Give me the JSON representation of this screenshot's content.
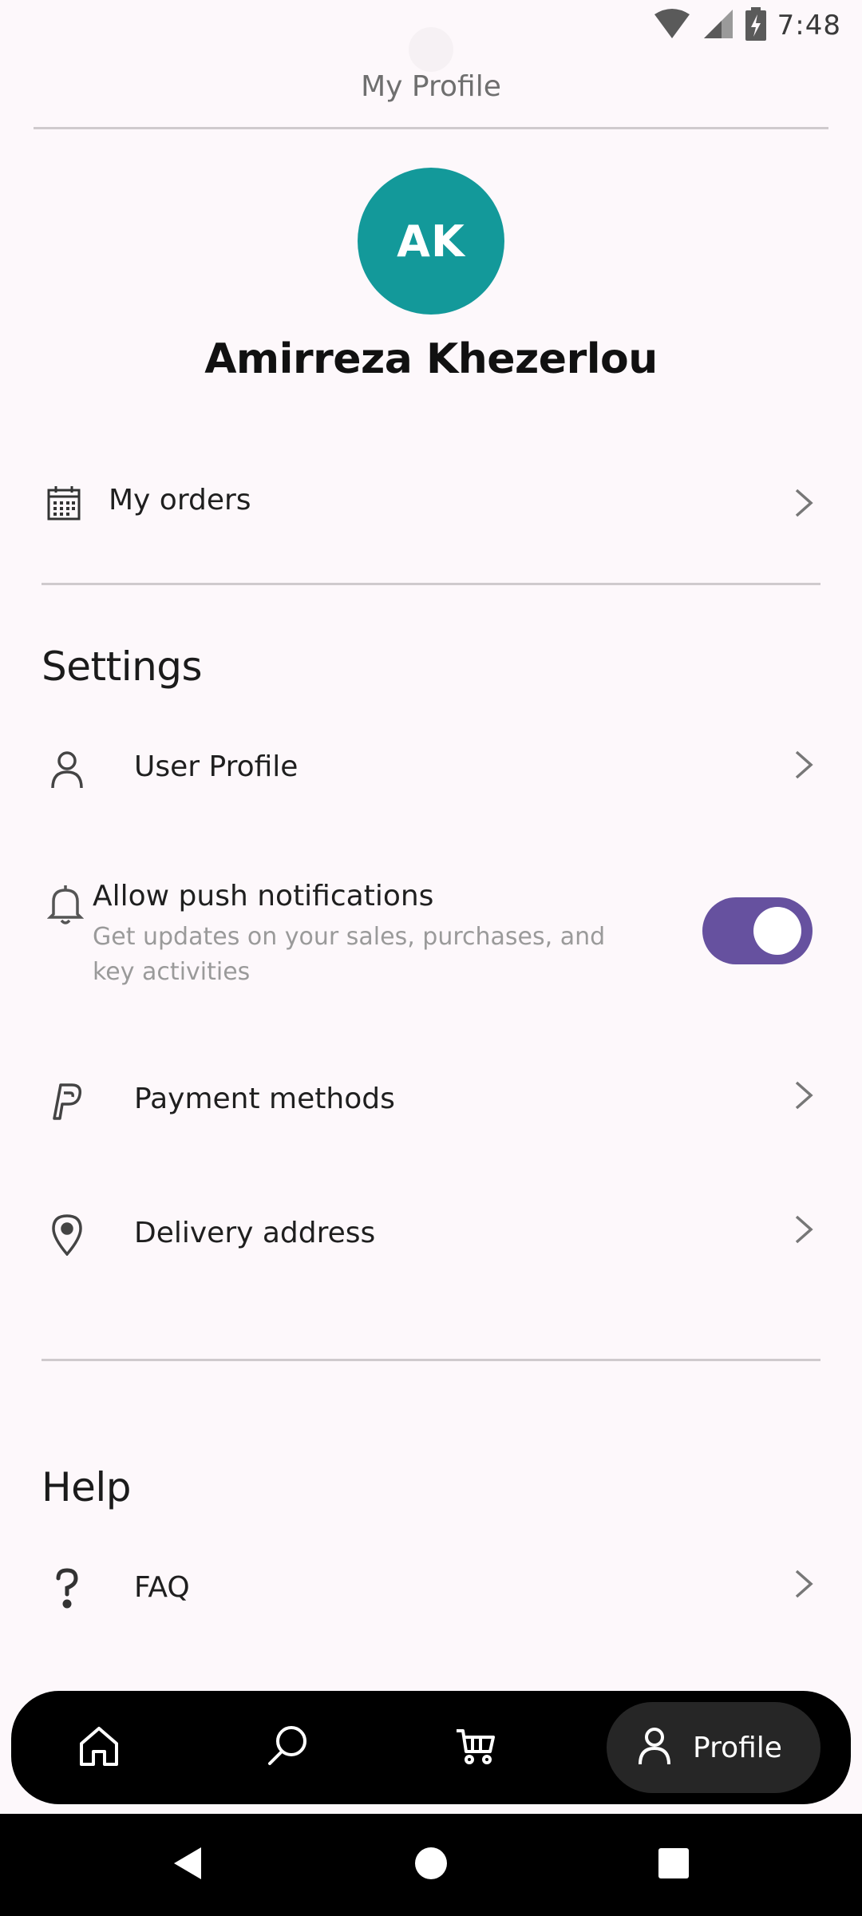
{
  "status_bar": {
    "time": "7:48"
  },
  "header": {
    "title": "My Profile"
  },
  "profile": {
    "initials": "AK",
    "name": "Amirreza Khezerlou",
    "avatar_color": "#13999A"
  },
  "orders": {
    "label": "My orders"
  },
  "settings": {
    "title": "Settings",
    "user_profile": "User Profile",
    "push": {
      "title": "Allow push notifications",
      "subtitle": "Get updates on your sales, purchases, and key activities",
      "enabled": true,
      "toggle_color": "#66519F"
    },
    "payment_methods": "Payment methods",
    "delivery_address": "Delivery address"
  },
  "help": {
    "title": "Help",
    "faq": "FAQ"
  },
  "bottom_nav": {
    "items": [
      "home-icon",
      "search-icon",
      "cart-icon",
      "profile-icon"
    ],
    "active_label": "Profile"
  },
  "icons": {
    "orders": "calendar-icon",
    "user_profile": "user-icon",
    "push": "bell-icon",
    "payment": "paypal-icon",
    "delivery": "location-pin-icon",
    "faq": "question-mark-icon"
  }
}
